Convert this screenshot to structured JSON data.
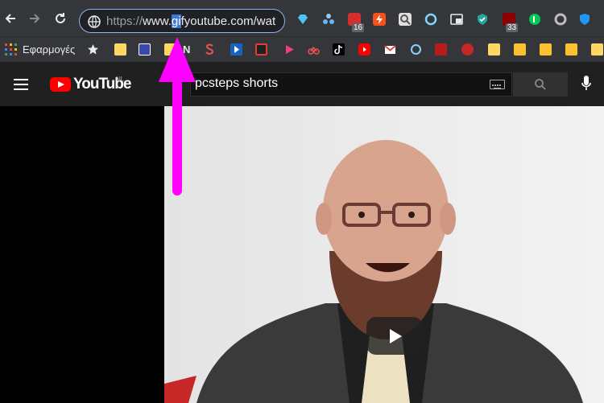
{
  "browser": {
    "url_scheme": "https://",
    "url_pre": "www.",
    "url_selected": "gi",
    "url_post": "fyoutube.com/wat",
    "extension_badges": [
      "16",
      "33"
    ]
  },
  "bookmarks": {
    "apps_label": "Εφαρμογές",
    "n_label": "N"
  },
  "youtube": {
    "logo_text": "YouTube",
    "region": "NL",
    "search_query": "pcsteps shorts"
  },
  "colors": {
    "annotation": "#ff00ff",
    "youtube_red": "#ff0000"
  }
}
